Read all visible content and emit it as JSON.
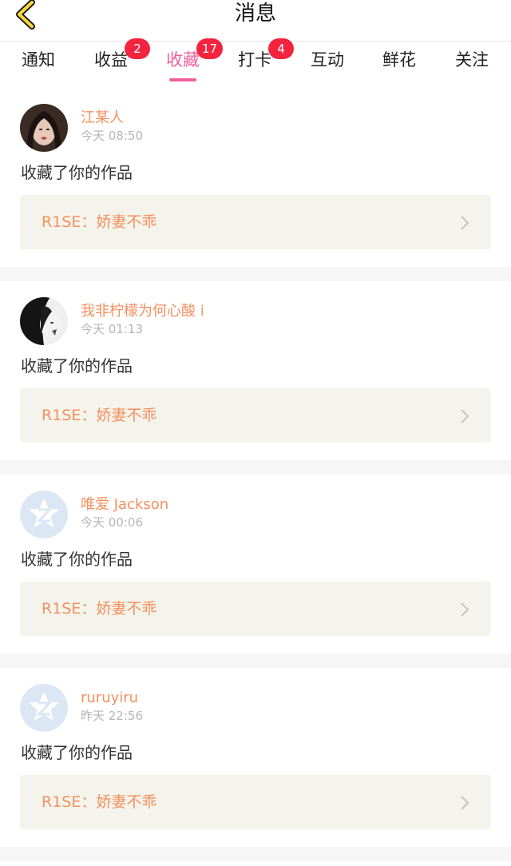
{
  "header": {
    "title": "消息"
  },
  "tabs": [
    {
      "label": "通知",
      "badge": ""
    },
    {
      "label": "收益",
      "badge": "2"
    },
    {
      "label": "收藏",
      "badge": "17"
    },
    {
      "label": "打卡",
      "badge": "4"
    },
    {
      "label": "互动",
      "badge": ""
    },
    {
      "label": "鲜花",
      "badge": ""
    },
    {
      "label": "关注",
      "badge": ""
    }
  ],
  "active_tab": "收藏",
  "colors": {
    "accent": "#f0609c",
    "badge": "#f4243e",
    "username": "#f58f5e",
    "work_bg": "#f4f4ec"
  },
  "items": [
    {
      "user": "江某人",
      "time": "今天 08:50",
      "action": "收藏了你的作品",
      "work": "R1SE：娇妻不乖",
      "avatar": "photo"
    },
    {
      "user": "我非柠檬为何心酸 i",
      "time": "今天 01:13",
      "action": "收藏了你的作品",
      "work": "R1SE：娇妻不乖",
      "avatar": "photo"
    },
    {
      "user": "唯爱 Jackson",
      "time": "今天 00:06",
      "action": "收藏了你的作品",
      "work": "R1SE：娇妻不乖",
      "avatar": "default-z-icon"
    },
    {
      "user": "ruruyiru",
      "time": "昨天 22:56",
      "action": "收藏了你的作品",
      "work": "R1SE：娇妻不乖",
      "avatar": "default-z-icon"
    }
  ]
}
